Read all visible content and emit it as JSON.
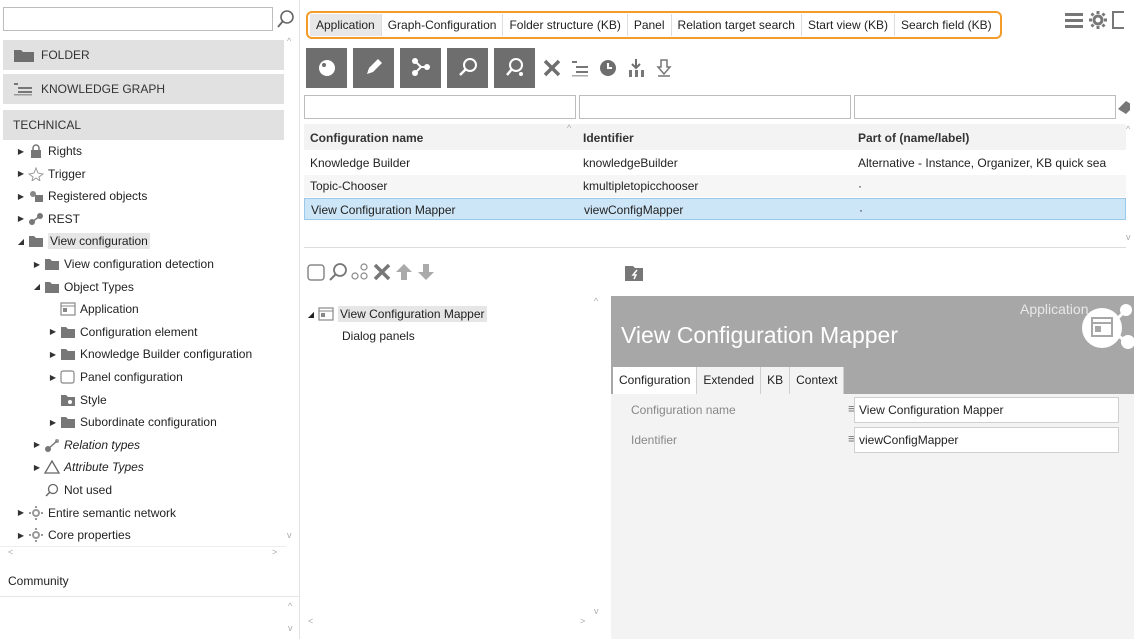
{
  "search": {
    "value": "",
    "placeholder": ""
  },
  "left": {
    "folder_label": "FOLDER",
    "kg_label": "KNOWLEDGE GRAPH",
    "technical_label": "TECHNICAL",
    "community_label": "Community",
    "tree": [
      {
        "label": "Rights",
        "icon": "lock-icon",
        "arrow": "▶"
      },
      {
        "label": "Trigger",
        "icon": "trigger-icon",
        "arrow": "▶"
      },
      {
        "label": "Registered objects",
        "icon": "registered-objects-icon",
        "arrow": "▶"
      },
      {
        "label": "REST",
        "icon": "rest-icon",
        "arrow": "▶"
      },
      {
        "label": "View configuration",
        "icon": "folder-icon",
        "arrow": "◢"
      },
      {
        "label": "View configuration detection",
        "icon": "folder-icon",
        "arrow": "▶"
      },
      {
        "label": "Object Types",
        "icon": "folder-icon",
        "arrow": "◢"
      },
      {
        "label": "Application",
        "icon": "application-icon",
        "arrow": ""
      },
      {
        "label": "Configuration element",
        "icon": "folder-icon",
        "arrow": "▶"
      },
      {
        "label": "Knowledge Builder configuration",
        "icon": "folder-icon",
        "arrow": "▶"
      },
      {
        "label": "Panel configuration",
        "icon": "panel-icon",
        "arrow": "▶"
      },
      {
        "label": "Style",
        "icon": "style-icon",
        "arrow": ""
      },
      {
        "label": "Subordinate configuration",
        "icon": "folder-icon",
        "arrow": "▶"
      },
      {
        "label": "Relation types",
        "icon": "relation-icon",
        "arrow": "▶"
      },
      {
        "label": "Attribute Types",
        "icon": "attribute-icon",
        "arrow": "▶"
      },
      {
        "label": "Not used",
        "icon": "search-icon",
        "arrow": ""
      },
      {
        "label": "Entire semantic network",
        "icon": "gear-icon",
        "arrow": "▶"
      },
      {
        "label": "Core properties",
        "icon": "gear-icon",
        "arrow": "▶"
      }
    ]
  },
  "tabs": [
    {
      "label": "Application"
    },
    {
      "label": "Graph-Configuration"
    },
    {
      "label": "Folder structure (KB)"
    },
    {
      "label": "Panel"
    },
    {
      "label": "Relation target search"
    },
    {
      "label": "Start view (KB)"
    },
    {
      "label": "Search field (KB)"
    }
  ],
  "table": {
    "columns": [
      "Configuration name",
      "Identifier",
      "Part of (name/label)"
    ],
    "rows": [
      [
        "Knowledge Builder",
        "knowledgeBuilder",
        "Alternative - Instance, Organizer, KB quick sea"
      ],
      [
        "Topic-Chooser",
        "kmultipletopicchooser",
        "·"
      ],
      [
        "View Configuration Mapper",
        "viewConfigMapper",
        "·"
      ]
    ]
  },
  "lower_tree": [
    {
      "label": "View Configuration Mapper",
      "arrow": "◢"
    },
    {
      "label": "Dialog panels",
      "arrow": ""
    }
  ],
  "detail": {
    "title": "View Configuration Mapper",
    "type_label": "Application",
    "tabs": [
      "Configuration",
      "Extended",
      "KB",
      "Context"
    ],
    "fields": [
      {
        "label": "Configuration name",
        "value": "View Configuration Mapper"
      },
      {
        "label": "Identifier",
        "value": "viewConfigMapper"
      }
    ]
  },
  "colors": {
    "accent": "#f39c28",
    "toolbar_button": "#6e6e6e",
    "selection": "#cde6f7",
    "header_gray": "#a7a7a7"
  }
}
